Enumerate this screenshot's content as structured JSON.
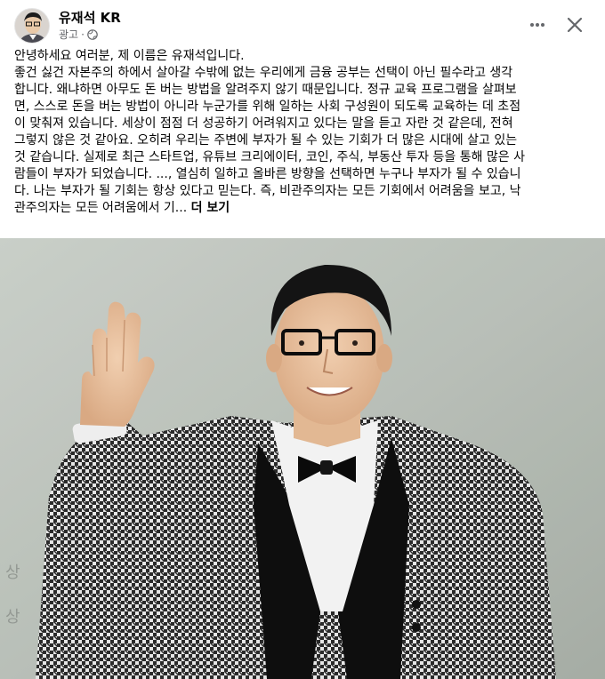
{
  "post": {
    "author": "유재석 KR",
    "sponsored_label": "광고",
    "separator": "·",
    "body_lines": [
      "안녕하세요 여러분, 제 이름은 유재석입니다.",
      "좋건 싫건 자본주의 하에서 살아갈 수밖에 없는 우리에게 금융 공부는 선택이 아닌 필수라고 생각",
      "합니다. 왜냐하면 아무도 돈 버는 방법을 알려주지 않기 때문입니다. 정규 교육 프로그램을 살펴보",
      "면, 스스로 돈을 버는 방법이 아니라 누군가를 위해 일하는 사회 구성원이 되도록 교육하는 데 초점",
      "이 맞춰져 있습니다. 세상이 점점 더 성공하기 어려워지고 있다는 말을 듣고 자란 것 같은데, 전혀",
      "그렇지 않은 것 같아요. 오히려 우리는 주변에 부자가 될 수 있는 기회가 더 많은 시대에 살고 있는",
      "것 같습니다. 실제로 최근 스타트업, 유튜브 크리에이터, 코인, 주식, 부동산 투자 등을 통해 많은 사",
      "람들이 부자가 되었습니다. ..., 열심히 일하고 올바른 방향을 선택하면 누구나 부자가 될 수 있습니",
      "다. 나는 부자가 될 기회는 항상 있다고 믿는다. 즉, 비관주의자는 모든 기회에서 어려움을 보고, 낙",
      "관주의자는 모든 어려움에서 기..."
    ],
    "see_more": "더 보기",
    "background_sign_text": [
      "상",
      "상"
    ]
  },
  "icons": {
    "more": "more-horizontal-icon",
    "close": "close-icon",
    "privacy": "globe-icon"
  },
  "colors": {
    "text": "#050505",
    "secondary_text": "#65676b",
    "photo_background": "#aeb5ad"
  }
}
